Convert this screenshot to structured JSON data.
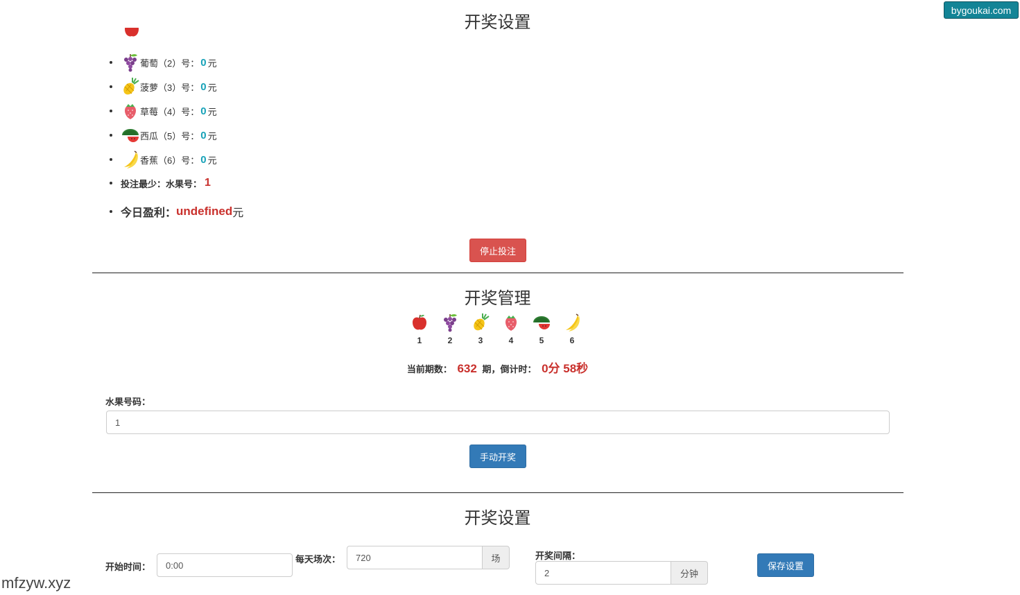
{
  "corner_badge": "bygoukai.com",
  "watermark": "mfzyw.xyz",
  "section1": {
    "title": "开奖设置",
    "fruits": [
      {
        "name": "葡萄",
        "num_label": "（2）号：",
        "amount": "0",
        "unit": "元",
        "icon": "grape-icon"
      },
      {
        "name": "菠萝",
        "num_label": "（3）号：",
        "amount": "0",
        "unit": "元",
        "icon": "pineapple-icon"
      },
      {
        "name": "草莓",
        "num_label": "（4）号：",
        "amount": "0",
        "unit": "元",
        "icon": "strawberry-icon"
      },
      {
        "name": "西瓜",
        "num_label": "（5）号：",
        "amount": "0",
        "unit": "元",
        "icon": "watermelon-icon"
      },
      {
        "name": "香蕉",
        "num_label": "（6）号：",
        "amount": "0",
        "unit": "元",
        "icon": "banana-icon"
      }
    ],
    "min_bet_label": "投注最少：水果号：",
    "min_bet_value": "1",
    "profit_label": "今日盈利：",
    "profit_value": "undefined",
    "profit_unit": "元",
    "stop_button": "停止投注"
  },
  "section2": {
    "title": "开奖管理",
    "fruit_numbers": [
      "1",
      "2",
      "3",
      "4",
      "5",
      "6"
    ],
    "period_label": "当前期数：",
    "period_value": "632",
    "period_suffix": "期，倒计时：",
    "countdown": "0分 58秒",
    "fruit_code_label": "水果号码：",
    "fruit_code_value": "1",
    "manual_button": "手动开奖"
  },
  "section3": {
    "title": "开奖设置",
    "start_time_label": "开始时间：",
    "start_time_value": "0:00",
    "daily_count_label": "每天场次：",
    "daily_count_value": "720",
    "daily_count_unit": "场",
    "interval_label": "开奖间隔：",
    "interval_value": "2",
    "interval_unit": "分钟",
    "save_button": "保存设置"
  },
  "colors": {
    "amount_teal": "#17a2b8",
    "value_red": "#c9302c",
    "danger": "#d9534f",
    "primary": "#337ab7"
  }
}
